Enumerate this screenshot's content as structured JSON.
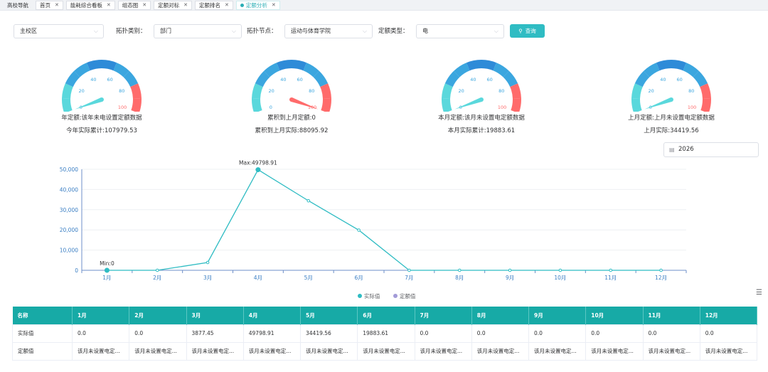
{
  "tabs": [
    {
      "label": "高校导航",
      "closable": false,
      "active": false
    },
    {
      "label": "首页",
      "closable": true,
      "active": false
    },
    {
      "label": "能耗综合看板",
      "closable": true,
      "active": false
    },
    {
      "label": "组态图",
      "closable": true,
      "active": false
    },
    {
      "label": "定额对标",
      "closable": true,
      "active": false
    },
    {
      "label": "定额排名",
      "closable": true,
      "active": false
    },
    {
      "label": "定额分析",
      "closable": true,
      "active": true
    }
  ],
  "filters": {
    "campus": "主校区",
    "topo_type_label": "拓扑类别：",
    "topo_type": "部门",
    "topo_node_label": "拓扑节点：",
    "topo_node": "运动与体育学院",
    "quota_type_label": "定额类型：",
    "quota_type": "电",
    "query_button": "查询"
  },
  "gauges": [
    {
      "line1": "年定额:该年未电设置定额数据",
      "line2": "今年实际累计:107979.53",
      "value": 0
    },
    {
      "line1": "累积到上月定额:0",
      "line2": "累积到上月实际:88095.92",
      "value": 100
    },
    {
      "line1": "本月定额:该月未设置电定额数据",
      "line2": "本月实际累计:19883.61",
      "value": 0
    },
    {
      "line1": "上月定额:上月未设置电定额数据",
      "line2": "上月实际:34419.56",
      "value": 0
    }
  ],
  "gauge_ticks": [
    "0",
    "20",
    "40",
    "60",
    "80",
    "100"
  ],
  "year": "2026",
  "chart_data": {
    "type": "line",
    "categories": [
      "1月",
      "2月",
      "3月",
      "4月",
      "5月",
      "6月",
      "7月",
      "8月",
      "9月",
      "10月",
      "11月",
      "12月"
    ],
    "series": [
      {
        "name": "实际值",
        "values": [
          0,
          0,
          3877.45,
          49798.91,
          34419.56,
          19883.61,
          0,
          0,
          0,
          0,
          0,
          0
        ],
        "color": "#2fbcc3"
      },
      {
        "name": "定额值",
        "values": [],
        "color": "#a29bd8"
      }
    ],
    "y_ticks": [
      "0",
      "10,000",
      "20,000",
      "30,000",
      "40,000",
      "50,000"
    ],
    "ylim": [
      0,
      50000
    ],
    "max_label": "Max:49798.91",
    "min_label": "Min:0"
  },
  "table": {
    "headers": [
      "名称",
      "1月",
      "2月",
      "3月",
      "4月",
      "5月",
      "6月",
      "7月",
      "8月",
      "9月",
      "10月",
      "11月",
      "12月"
    ],
    "rows": [
      [
        "实际值",
        "0.0",
        "0.0",
        "3877.45",
        "49798.91",
        "34419.56",
        "19883.61",
        "0.0",
        "0.0",
        "0.0",
        "0.0",
        "0.0",
        "0.0"
      ],
      [
        "定额值",
        "该月未设置电定...",
        "该月未设置电定...",
        "该月未设置电定...",
        "该月未设置电定...",
        "该月未设置电定...",
        "该月未设置电定...",
        "该月未设置电定...",
        "该月未设置电定...",
        "该月未设置电定...",
        "该月未设置电定...",
        "该月未设置电定...",
        "该月未设置电定..."
      ]
    ]
  }
}
